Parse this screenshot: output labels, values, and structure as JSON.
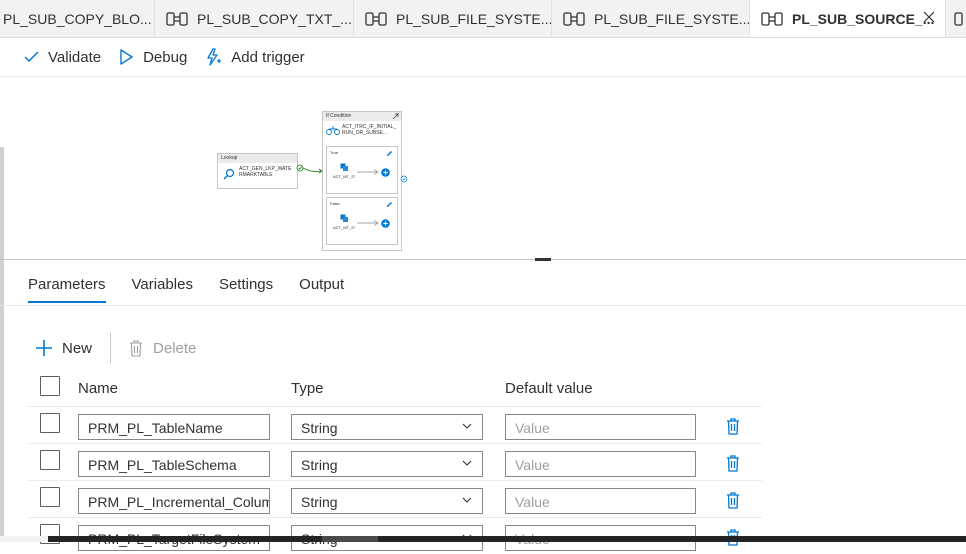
{
  "tabs": [
    {
      "label": "PL_SUB_COPY_BLO...",
      "icon": "pipeline-icon",
      "active": false
    },
    {
      "label": "PL_SUB_COPY_TXT_...",
      "icon": "pipeline-icon",
      "active": false
    },
    {
      "label": "PL_SUB_FILE_SYSTE...",
      "icon": "pipeline-icon",
      "active": false
    },
    {
      "label": "PL_SUB_FILE_SYSTE...",
      "icon": "pipeline-icon",
      "active": false
    },
    {
      "label": "PL_SUB_SOURCE_...",
      "icon": "pipeline-icon",
      "active": true
    }
  ],
  "toolbar": {
    "validate_label": "Validate",
    "debug_label": "Debug",
    "add_trigger_label": "Add trigger"
  },
  "canvas": {
    "lookup": {
      "title": "Lookup",
      "name": "ACT_GEN_LKP_WATERMARKTABLE"
    },
    "if_condition": {
      "title": "If Condition",
      "name": "ACT_ITRC_IF_INITIAL_RUN_OR_SUBSE...",
      "true_label": "True",
      "false_label": "False",
      "true_activity": "ACT_MT_ST_COPY_INIT...",
      "false_activity": "ACT_MT_ST_COPY_INC..."
    }
  },
  "property_tabs": [
    {
      "label": "Parameters",
      "active": true
    },
    {
      "label": "Variables",
      "active": false
    },
    {
      "label": "Settings",
      "active": false
    },
    {
      "label": "Output",
      "active": false
    }
  ],
  "commands": {
    "new_label": "New",
    "delete_label": "Delete"
  },
  "table": {
    "columns": [
      "Name",
      "Type",
      "Default value"
    ],
    "rows": [
      {
        "name": "PRM_PL_TableName",
        "type": "String",
        "default_placeholder": "Value"
      },
      {
        "name": "PRM_PL_TableSchema",
        "type": "String",
        "default_placeholder": "Value"
      },
      {
        "name": "PRM_PL_Incremental_Column",
        "type": "String",
        "default_placeholder": "Value"
      },
      {
        "name": "PRM_PL_TargetFileSystem",
        "type": "String",
        "default_placeholder": "Value"
      }
    ]
  },
  "colors": {
    "accent": "#0078d4",
    "text": "#323130",
    "border": "#8a8886",
    "tab_bg": "#f3f2f1"
  }
}
